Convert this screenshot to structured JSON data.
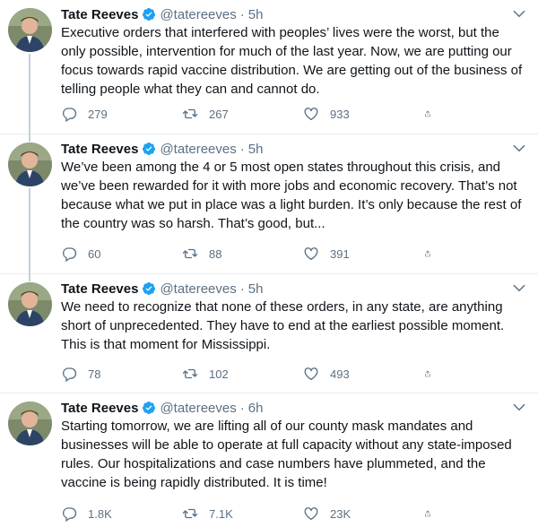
{
  "author": {
    "name": "Tate Reeves",
    "handle": "@tatereeves"
  },
  "separator": "·",
  "tweets": [
    {
      "time": "5h",
      "text": "Executive orders that interfered with peoples’ lives were the worst, but the only possible, intervention for much of the last year. Now, we are putting our focus towards rapid vaccine distribution. We are getting out of the business of telling people what they can and cannot do.",
      "replies": "279",
      "retweets": "267",
      "likes": "933"
    },
    {
      "time": "5h",
      "text": "We’ve been among the 4 or 5 most open states throughout this crisis, and we’ve been rewarded for it with more jobs and economic recovery. That’s not because what we put in place was a light burden. It’s only because the rest of the country was so harsh. That’s good, but...",
      "replies": "60",
      "retweets": "88",
      "likes": "391"
    },
    {
      "time": "5h",
      "text": "We need to recognize that none of these orders, in any state, are anything short of unprecedented. They have to end at the earliest possible moment. This is that moment for Mississippi.",
      "replies": "78",
      "retweets": "102",
      "likes": "493"
    },
    {
      "time": "6h",
      "text": "Starting tomorrow, we are lifting all of our county mask mandates and businesses will be able to operate at full capacity without any state-imposed rules. Our hospitalizations and case numbers have plummeted, and the vaccine is being rapidly distributed. It is time!",
      "replies": "1.8K",
      "retweets": "7.1K",
      "likes": "23K"
    }
  ],
  "colors": {
    "verified": "#1da1f2",
    "muted": "#5b7083",
    "border": "#e6ecf0",
    "thread": "#c4cfd6"
  },
  "icons": [
    "verified-badge-icon",
    "more-icon",
    "reply-icon",
    "retweet-icon",
    "like-icon",
    "share-icon"
  ]
}
